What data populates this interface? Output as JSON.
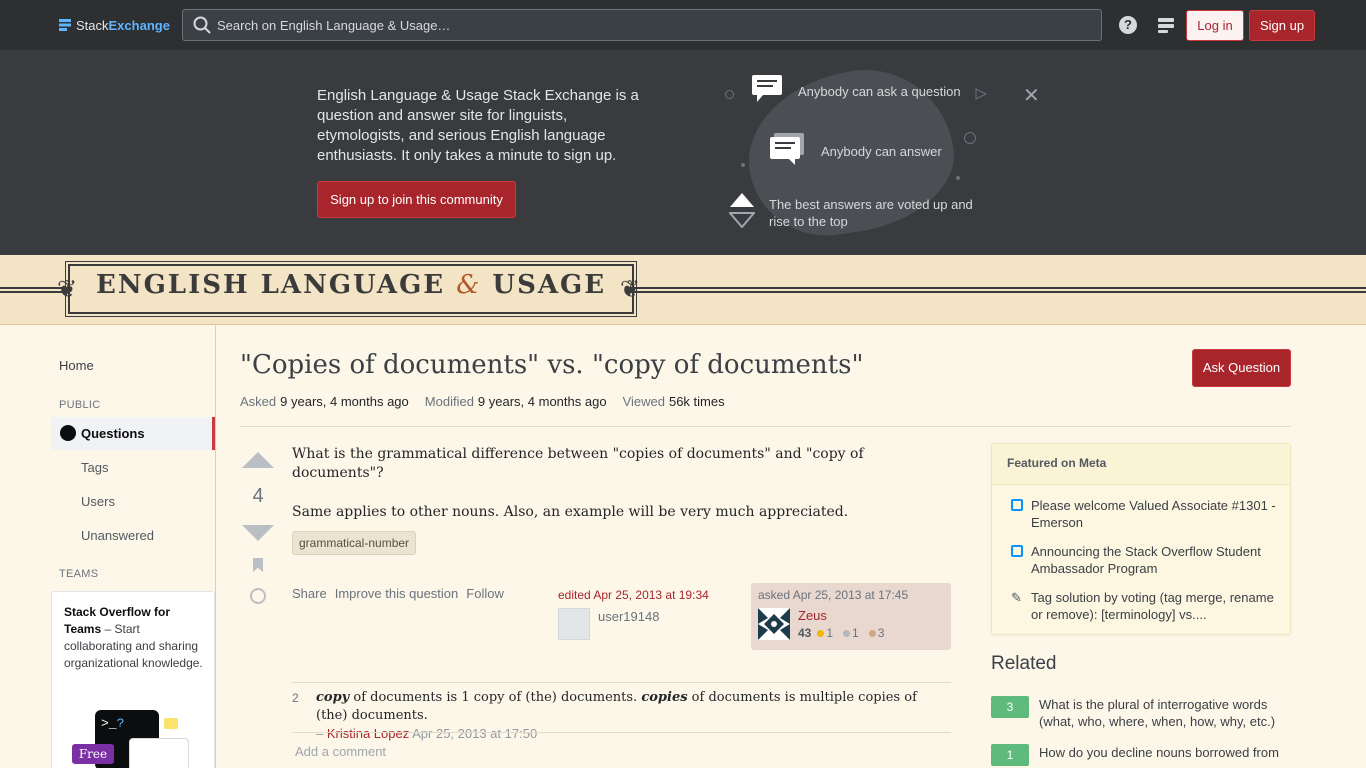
{
  "topbar": {
    "brand_stack": "Stack",
    "brand_exchange": "Exchange",
    "search_placeholder": "Search on English Language & Usage…",
    "help_label": "?",
    "login_label": "Log in",
    "signup_label": "Sign up"
  },
  "hero": {
    "text": "English Language & Usage Stack Exchange is a question and answer site for linguists, etymologists, and serious English language enthusiasts. It only takes a minute to sign up.",
    "cta_label": "Sign up to join this community",
    "features": [
      "Anybody can ask a question",
      "Anybody can answer",
      "The best answers are voted up and rise to the top"
    ],
    "close_label": "✕"
  },
  "banner": {
    "title_part1": "ENGLISH LANGUAGE",
    "amp": "&",
    "title_part2": "USAGE"
  },
  "sidebar": {
    "home": "Home",
    "public_label": "PUBLIC",
    "questions": "Questions",
    "items": [
      "Tags",
      "Users",
      "Unanswered"
    ],
    "teams_label": "TEAMS",
    "teams_title": "Stack Overflow for Teams",
    "teams_desc": " – Start collaborating and sharing organizational knowledge.",
    "teams_terminal": ">_",
    "teams_q": "?",
    "free_badge": "Free"
  },
  "question": {
    "title": "\"Copies of documents\" vs. \"copy of documents\"",
    "ask_label": "Ask Question",
    "asked_key": "Asked",
    "asked_val": "9 years, 4 months ago",
    "modified_key": "Modified",
    "modified_val": "9 years, 4 months ago",
    "viewed_key": "Viewed",
    "viewed_val": "56k times",
    "votes": "4",
    "body": [
      "What is the grammatical difference between \"copies of documents\" and \"copy of documents\"?",
      "Same applies to other nouns. Also, an example will be very much appreciated."
    ],
    "tag": "grammatical-number",
    "menu": [
      "Share",
      "Improve this question",
      "Follow"
    ],
    "edited_action": "edited Apr 25, 2013 at 19:34",
    "editor_name": "user19148",
    "asked_action": "asked Apr 25, 2013 at 17:45",
    "owner_name": "Zeus",
    "owner_rep": "43",
    "badge_gold": "1",
    "badge_silver": "1",
    "badge_bronze": "3"
  },
  "comment": {
    "score": "2",
    "em1": "copy",
    "text1": " of documents is 1 copy of (the) documents. ",
    "em2": "copies",
    "text2": " of documents is multiple copies of (the) documents.",
    "dash": " – ",
    "user": "Kristina Lopez",
    "date": " Apr 25, 2013 at 17:50"
  },
  "add_comment": "Add a comment",
  "featured": {
    "title": "Featured on Meta",
    "items": [
      "Please welcome Valued Associate #1301 - Emerson",
      "Announcing the Stack Overflow Student Ambassador Program",
      "Tag solution by voting (tag merge, rename or remove): [terminology] vs...."
    ]
  },
  "related": {
    "title": "Related",
    "items": [
      {
        "score": "3",
        "text": "What is the plural of interrogative words (what, who, where, when, how, why, etc.)"
      },
      {
        "score": "1",
        "text": "How do you decline nouns borrowed from"
      }
    ]
  },
  "colors": {
    "brand_red": "#a8252b",
    "topbar": "#2d2f31",
    "hero": "#393b3e",
    "banner": "#f4e4c6",
    "page": "#fdf7e9",
    "related_score": "#5eba7d"
  }
}
